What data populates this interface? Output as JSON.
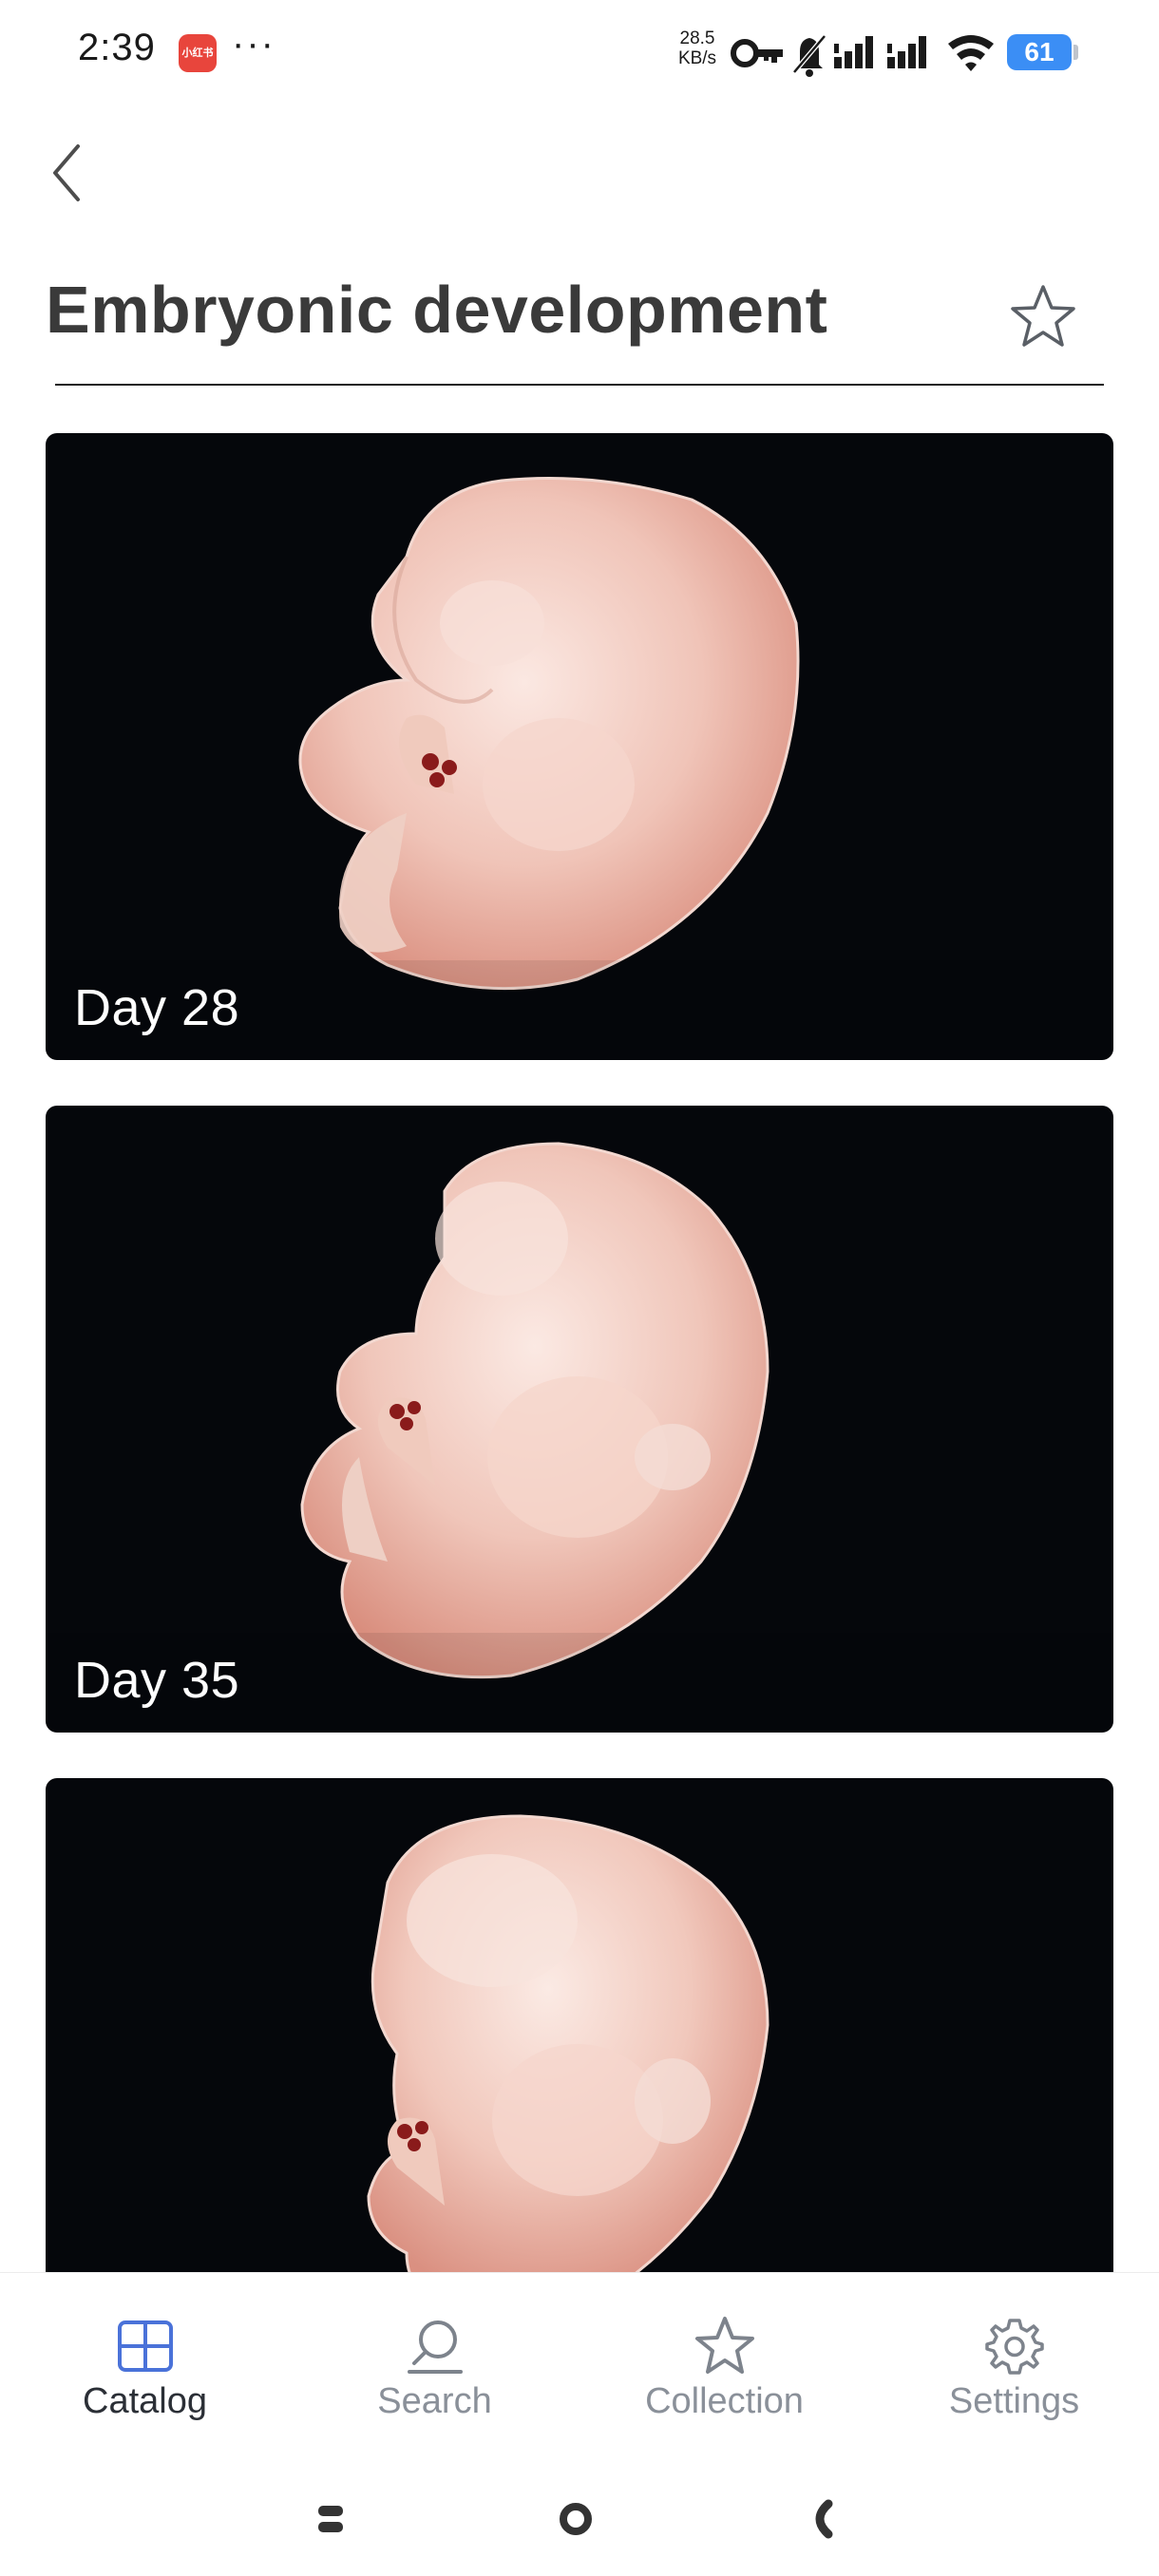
{
  "status_bar": {
    "time": "2:39",
    "app_badge": "小红书",
    "overflow": "···",
    "net_speed_value": "28.5",
    "net_speed_unit": "KB/s",
    "battery": "61"
  },
  "header": {
    "title": "Embryonic development"
  },
  "cards": [
    {
      "label": "Day 28"
    },
    {
      "label": "Day 35"
    },
    {
      "label": ""
    }
  ],
  "bottom_nav": {
    "items": [
      {
        "label": "Catalog",
        "icon": "catalog-grid-icon",
        "active": true
      },
      {
        "label": "Search",
        "icon": "search-icon",
        "active": false
      },
      {
        "label": "Collection",
        "icon": "star-icon",
        "active": false
      },
      {
        "label": "Settings",
        "icon": "gear-icon",
        "active": false
      }
    ]
  },
  "colors": {
    "accent": "#4a72d9",
    "card_bg": "#05070b",
    "title": "#3a3a3a",
    "nav_inactive": "#8a9099",
    "battery": "#3b8ef5"
  }
}
